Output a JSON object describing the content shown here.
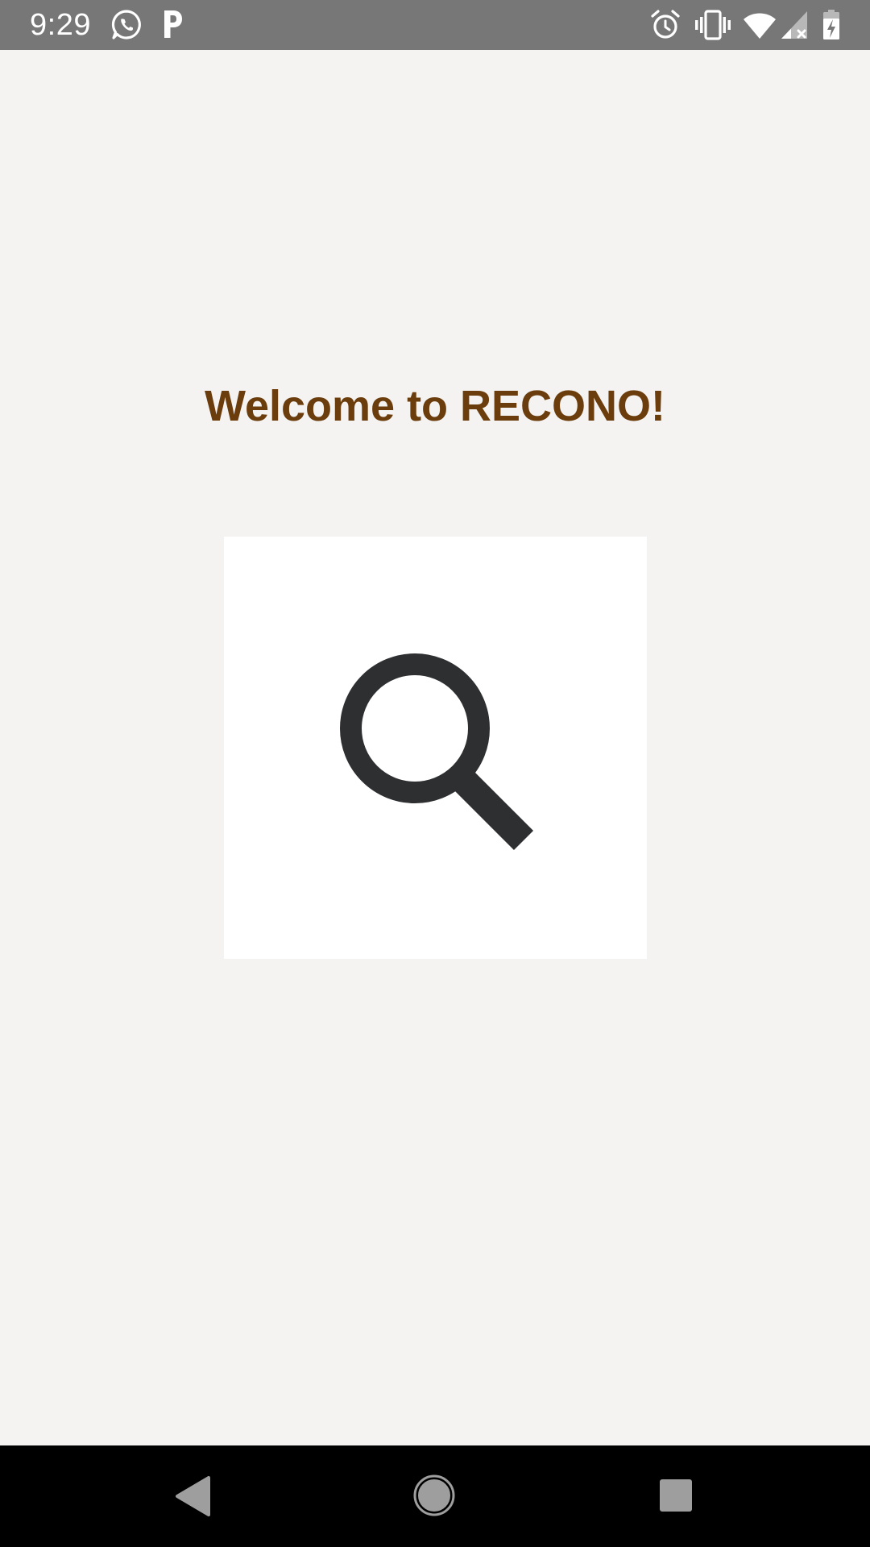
{
  "status_bar": {
    "time": "9:29",
    "background": "#777777",
    "left_icons": [
      "whatsapp-icon",
      "p-app-icon"
    ],
    "right_icons": [
      "alarm-icon",
      "vibrate-icon",
      "wifi-icon",
      "cell-signal-icon",
      "battery-charging-icon"
    ]
  },
  "main": {
    "title": "Welcome to RECONO!",
    "title_color": "#6b3d0c",
    "background": "#f4f3f2",
    "search_card": {
      "icon": "search-icon",
      "background": "#ffffff",
      "icon_color": "#2e2f31"
    }
  },
  "nav_bar": {
    "background": "#000000",
    "buttons": [
      "back-icon",
      "home-icon",
      "recents-icon"
    ],
    "button_color": "#9e9e9e"
  }
}
